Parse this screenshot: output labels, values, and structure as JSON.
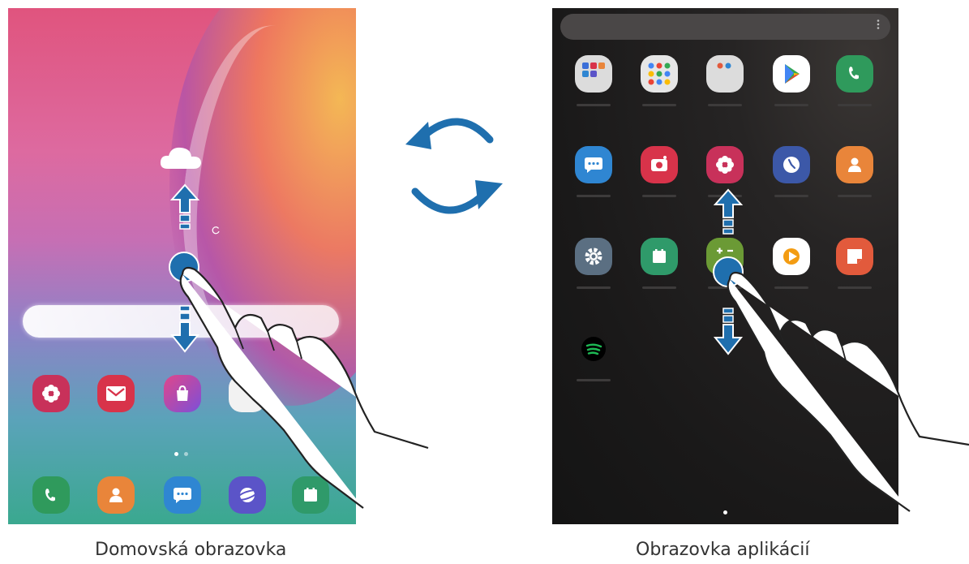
{
  "colors": {
    "accent_blue": "#1f6fae",
    "home_gradient_top": "#e0547e",
    "home_gradient_bottom": "#3aa88f",
    "apps_background": "#1a1919"
  },
  "home_screen": {
    "weather_icon": "cloud-icon",
    "refresh_icon": "refresh-icon",
    "dock_page_indicator": {
      "count": 2,
      "active_index": 0
    },
    "favorites": [
      {
        "icon": "gallery-icon",
        "color": "#c8315a"
      },
      {
        "icon": "email-icon",
        "color": "#d8334a"
      },
      {
        "icon": "galaxy-store-icon",
        "color": "#a548c8"
      },
      {
        "icon": "widget-icon",
        "color": "#f2f2f2"
      }
    ],
    "dock": [
      {
        "icon": "phone-icon",
        "color": "#2f9a5c"
      },
      {
        "icon": "contacts-icon",
        "color": "#e9853a"
      },
      {
        "icon": "messages-icon",
        "color": "#2f86d2"
      },
      {
        "icon": "internet-icon",
        "color": "#5b54c8"
      },
      {
        "icon": "calendar-icon",
        "color": "#2f9a6a"
      }
    ]
  },
  "apps_screen": {
    "more_options_icon": "more-vertical-icon",
    "page_indicator": {
      "count": 1,
      "active_index": 0
    },
    "apps": [
      {
        "icon": "samsung-folder-icon",
        "color": "#dcdcdc"
      },
      {
        "icon": "google-folder-icon",
        "color": "#e6e6e6"
      },
      {
        "icon": "microsoft-folder-icon",
        "color": "#dcdcdc"
      },
      {
        "icon": "play-store-icon",
        "color": "#ffffff"
      },
      {
        "icon": "phone-icon",
        "color": "#2f9a5c"
      },
      {
        "icon": "messages-icon",
        "color": "#2f86d2"
      },
      {
        "icon": "camera-icon",
        "color": "#d8334a"
      },
      {
        "icon": "gallery-icon",
        "color": "#c8315a"
      },
      {
        "icon": "clock-icon",
        "color": "#3c58a8"
      },
      {
        "icon": "contacts-icon",
        "color": "#e9853a"
      },
      {
        "icon": "settings-icon",
        "color": "#5b6f82"
      },
      {
        "icon": "calendar-icon",
        "color": "#2f9a6a"
      },
      {
        "icon": "calculator-icon",
        "color": "#6b9a35"
      },
      {
        "icon": "play-music-icon",
        "color": "#ffffff"
      },
      {
        "icon": "notes-icon",
        "color": "#e25a3c"
      },
      {
        "icon": "spotify-icon",
        "color": "#1db954"
      }
    ]
  },
  "gestures": {
    "swipe_icon": "swipe-up-down-icon",
    "rotate_icon": "switch-arrows-icon"
  },
  "captions": {
    "home": "Domovská obrazovka",
    "apps": "Obrazovka aplikácií"
  }
}
